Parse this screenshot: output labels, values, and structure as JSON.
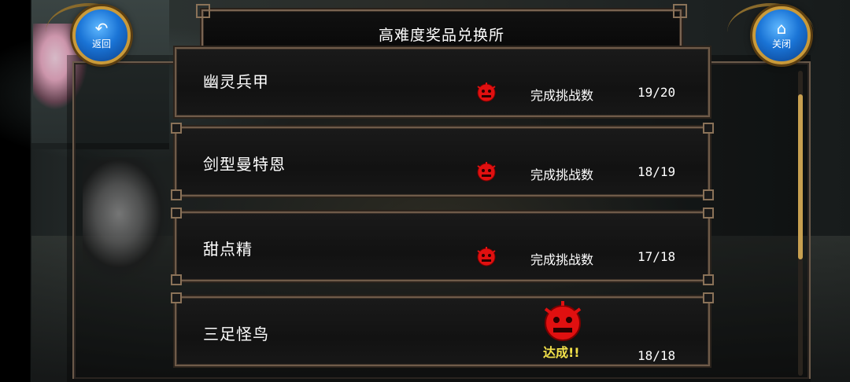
{
  "header": {
    "title": "高难度奖品兑换所",
    "back_label": "返回",
    "close_label": "关闭"
  },
  "items": [
    {
      "name": "幽灵兵甲",
      "label": "完成挑战数",
      "count": "19/20",
      "achieved": false
    },
    {
      "name": "剑型曼特恩",
      "label": "完成挑战数",
      "count": "18/19",
      "achieved": false
    },
    {
      "name": "甜点精",
      "label": "完成挑战数",
      "count": "17/18",
      "achieved": false
    },
    {
      "name": "三足怪鸟",
      "label": "",
      "count": "18/18",
      "achieved": true,
      "achieved_label": "达成!!"
    }
  ],
  "colors": {
    "badge_red": "#e01010",
    "achieved_yellow": "#f2e14a",
    "frame_brown": "#6f5b49",
    "button_blue": "#1a74d6"
  },
  "icons": {
    "back": "return-arrow-icon",
    "close": "home-icon",
    "badge": "demon-face-badge-icon"
  }
}
